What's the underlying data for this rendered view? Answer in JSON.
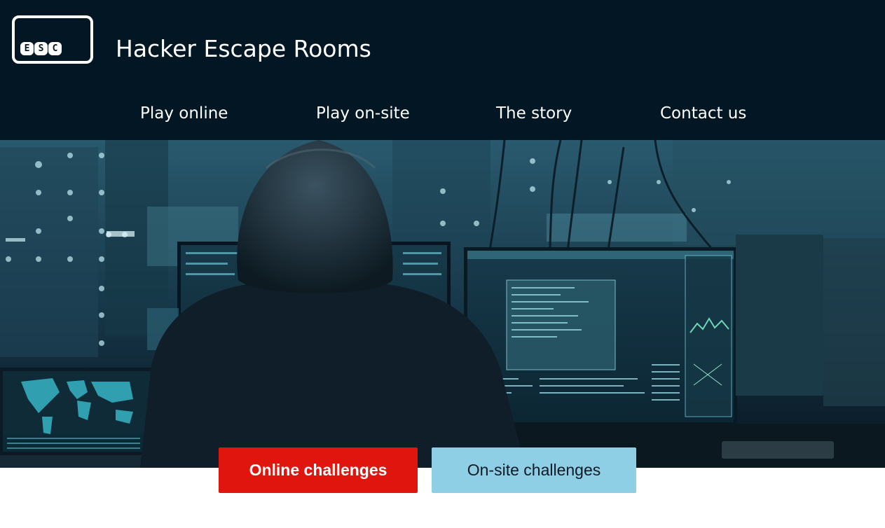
{
  "header": {
    "logo_keys": [
      "E",
      "S",
      "C"
    ],
    "title": "Hacker Escape Rooms"
  },
  "nav": {
    "items": [
      {
        "label": "Play online"
      },
      {
        "label": "Play on-site"
      },
      {
        "label": "The story"
      },
      {
        "label": "Contact us"
      }
    ]
  },
  "hero": {
    "image": "hooded-hacker-at-monitors"
  },
  "cta": {
    "online_label": "Online challenges",
    "onsite_label": "On-site challenges"
  },
  "colors": {
    "header_bg": "#021624",
    "online_button": "#e0150e",
    "onsite_button": "#8ecfe6"
  }
}
